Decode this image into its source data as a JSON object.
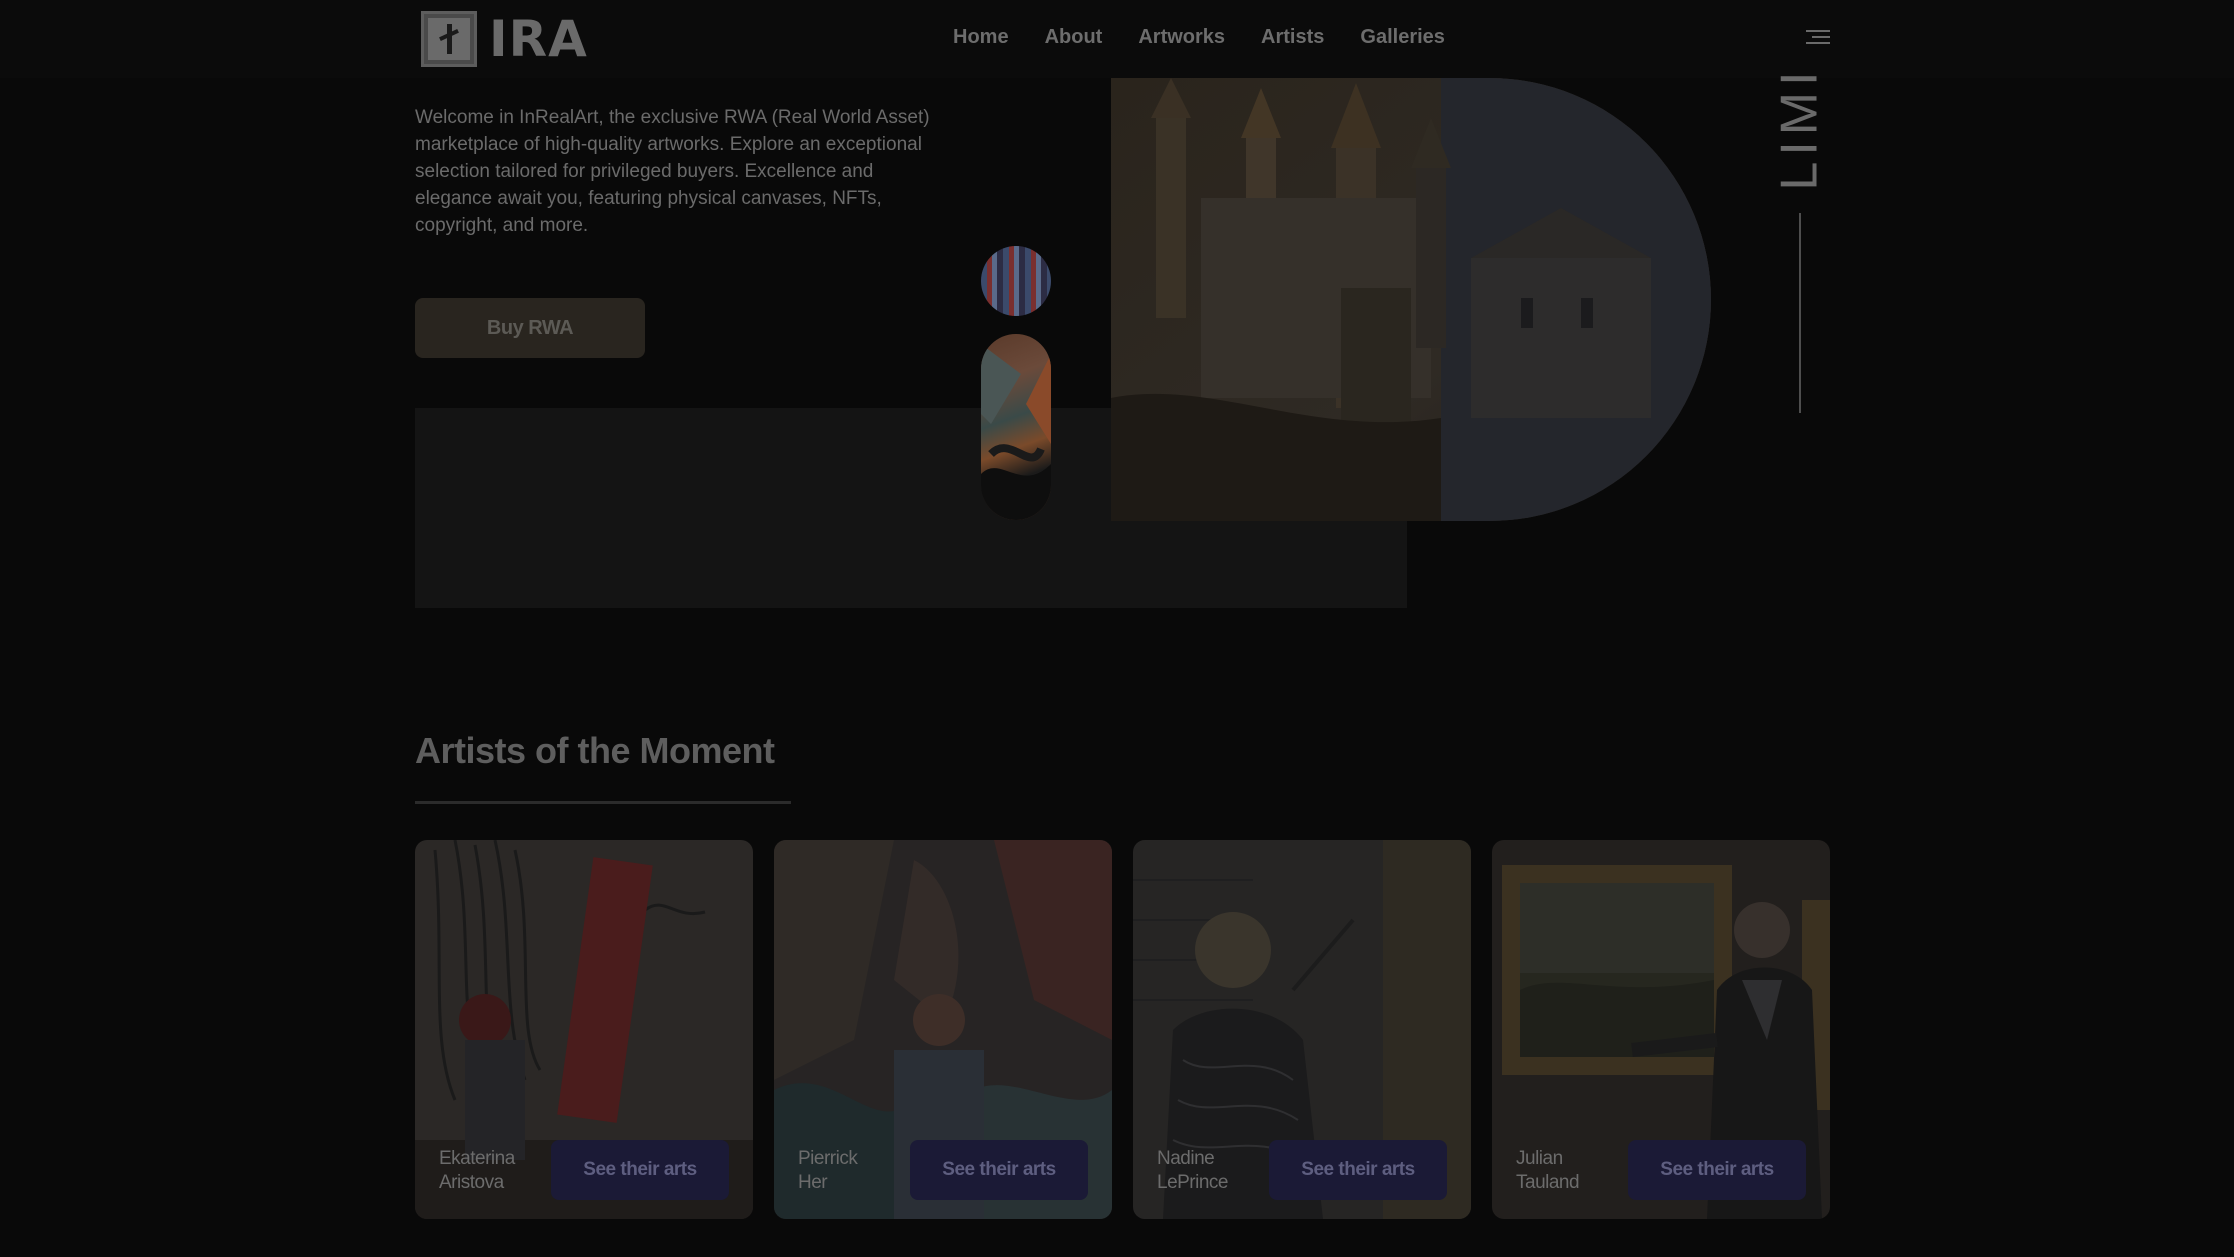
{
  "header": {
    "logo_text": "IRA",
    "nav": [
      {
        "label": "Home"
      },
      {
        "label": "About"
      },
      {
        "label": "Artworks"
      },
      {
        "label": "Artists"
      },
      {
        "label": "Galleries"
      }
    ],
    "menu_icon": "hamburger-menu-icon"
  },
  "hero": {
    "description": "Welcome in InRealArt, the exclusive RWA (Real World Asset) marketplace of high-quality artworks. Explore an exceptional selection tailored for privileged buyers. Excellence and elegance await you, featuring physical canvases, NFTs, copyright, and more.",
    "buy_button": "Buy RWA",
    "vertical_word": "LIMI"
  },
  "artists_section": {
    "title": "Artists of the Moment",
    "artists": [
      {
        "first": "Ekaterina",
        "last": "Aristova",
        "button": "See their arts"
      },
      {
        "first": "Pierrick",
        "last": "Her",
        "button": "See their arts"
      },
      {
        "first": "Nadine",
        "last": "LePrince",
        "button": "See their arts"
      },
      {
        "first": "Julian",
        "last": "Tauland",
        "button": "See their arts"
      }
    ]
  },
  "colors": {
    "background": "#090909",
    "button_dark_gold": "#29251f",
    "card_button": "#1b1a36"
  }
}
